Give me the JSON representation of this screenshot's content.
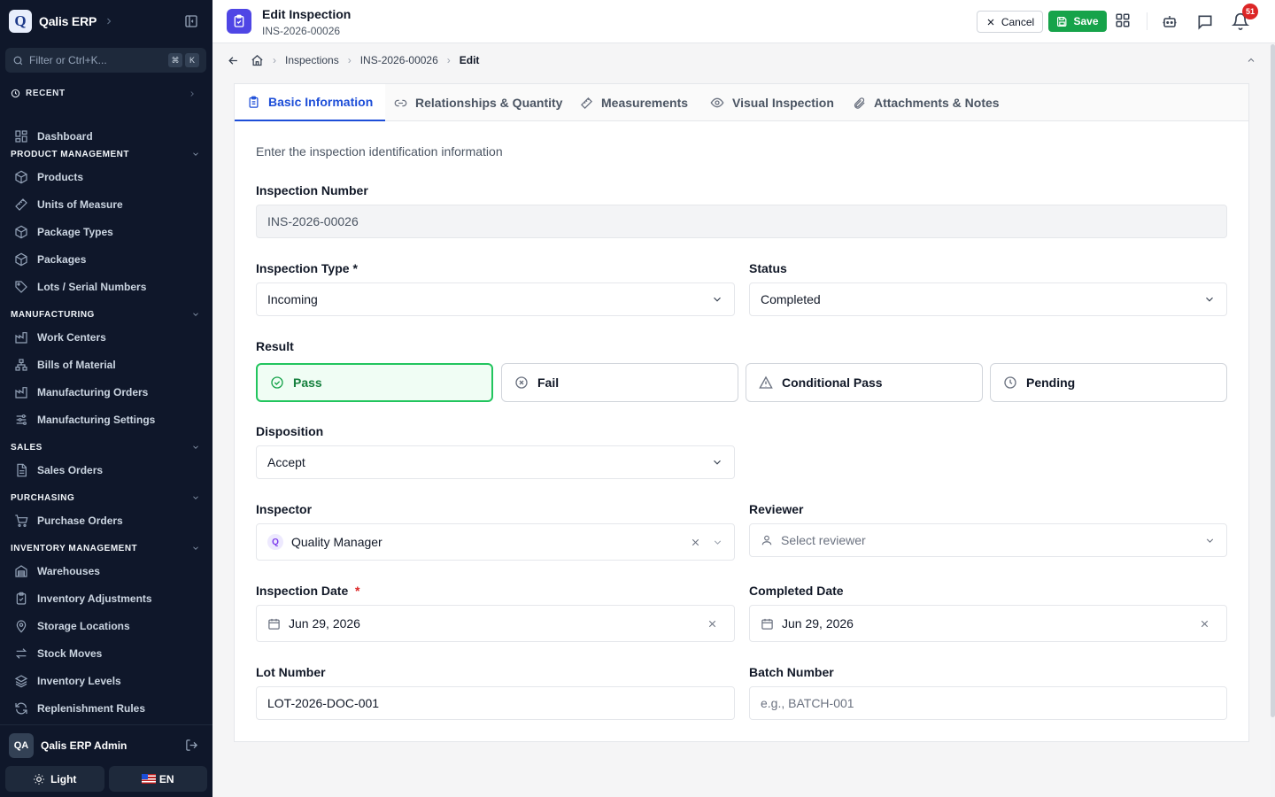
{
  "sidebar": {
    "brand": {
      "logo_letter": "Q",
      "name": "Qalis ERP"
    },
    "filter": {
      "placeholder": "Filter or Ctrl+K...",
      "kbd": [
        "⌘",
        "K"
      ]
    },
    "recent_label": "RECENT",
    "dashboard": "Dashboard",
    "groups": [
      {
        "title": "PRODUCT MANAGEMENT",
        "items": [
          {
            "label": "Products",
            "icon": "cube-icon"
          },
          {
            "label": "Units of Measure",
            "icon": "ruler-icon"
          },
          {
            "label": "Package Types",
            "icon": "cube-icon"
          },
          {
            "label": "Packages",
            "icon": "cube-icon"
          },
          {
            "label": "Lots / Serial Numbers",
            "icon": "tag-icon"
          }
        ]
      },
      {
        "title": "MANUFACTURING",
        "items": [
          {
            "label": "Work Centers",
            "icon": "factory-icon"
          },
          {
            "label": "Bills of Material",
            "icon": "hierarchy-icon"
          },
          {
            "label": "Manufacturing Orders",
            "icon": "factory-icon"
          },
          {
            "label": "Manufacturing Settings",
            "icon": "sliders-icon"
          }
        ]
      },
      {
        "title": "SALES",
        "items": [
          {
            "label": "Sales Orders",
            "icon": "document-icon"
          }
        ]
      },
      {
        "title": "PURCHASING",
        "items": [
          {
            "label": "Purchase Orders",
            "icon": "cart-icon"
          }
        ]
      },
      {
        "title": "INVENTORY MANAGEMENT",
        "items": [
          {
            "label": "Warehouses",
            "icon": "warehouse-icon"
          },
          {
            "label": "Inventory Adjustments",
            "icon": "clipboard-check-icon"
          },
          {
            "label": "Storage Locations",
            "icon": "map-pin-icon"
          },
          {
            "label": "Stock Moves",
            "icon": "arrows-icon"
          },
          {
            "label": "Inventory Levels",
            "icon": "layers-icon"
          },
          {
            "label": "Replenishment Rules",
            "icon": "refresh-icon"
          }
        ]
      }
    ],
    "user": {
      "initials": "QA",
      "name": "Qalis ERP Admin"
    },
    "theme_label": "Light",
    "lang_label": "EN"
  },
  "header": {
    "title": "Edit Inspection",
    "subtitle": "INS-2026-00026",
    "cancel_label": "Cancel",
    "save_label": "Save",
    "notification_count": "51"
  },
  "breadcrumb": {
    "items": [
      "Inspections",
      "INS-2026-00026"
    ],
    "current": "Edit"
  },
  "tabs": [
    {
      "label": "Basic Information",
      "icon": "clipboard-icon",
      "active": true
    },
    {
      "label": "Relationships & Quantity",
      "icon": "link-icon",
      "active": false
    },
    {
      "label": "Measurements",
      "icon": "ruler-icon",
      "active": false
    },
    {
      "label": "Visual Inspection",
      "icon": "eye-icon",
      "active": false
    },
    {
      "label": "Attachments & Notes",
      "icon": "paperclip-icon",
      "active": false
    }
  ],
  "form": {
    "description": "Enter the inspection identification information",
    "inspection_number": {
      "label": "Inspection Number",
      "value": "INS-2026-00026"
    },
    "inspection_type": {
      "label": "Inspection Type",
      "required_mark": "*",
      "value": "Incoming"
    },
    "status": {
      "label": "Status",
      "value": "Completed"
    },
    "result": {
      "label": "Result",
      "options": [
        "Pass",
        "Fail",
        "Conditional Pass",
        "Pending"
      ],
      "selected": "Pass"
    },
    "disposition": {
      "label": "Disposition",
      "value": "Accept"
    },
    "inspector": {
      "label": "Inspector",
      "avatar_letter": "Q",
      "value": "Quality Manager"
    },
    "reviewer": {
      "label": "Reviewer",
      "placeholder": "Select reviewer"
    },
    "inspection_date": {
      "label": "Inspection Date",
      "required_mark": "*",
      "value": "Jun 29, 2026"
    },
    "completed_date": {
      "label": "Completed Date",
      "value": "Jun 29, 2026"
    },
    "lot_number": {
      "label": "Lot Number",
      "value": "LOT-2026-DOC-001"
    },
    "batch_number": {
      "label": "Batch Number",
      "placeholder": "e.g., BATCH-001"
    }
  },
  "colors": {
    "primary": "#1d4ed8",
    "success": "#16a34a",
    "sidebar_bg": "#0f172a",
    "danger": "#dc2626"
  }
}
